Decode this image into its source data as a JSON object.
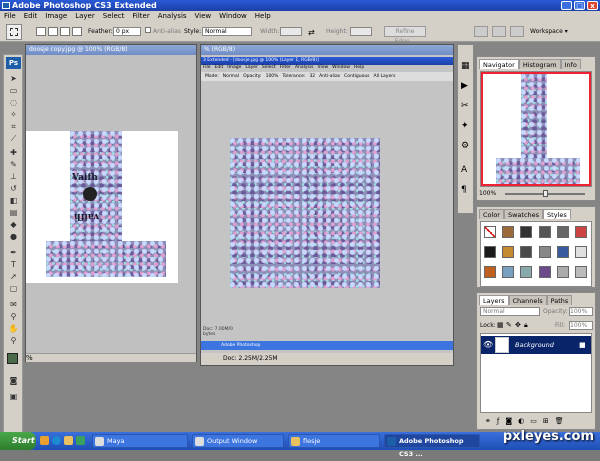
{
  "window": {
    "title": "Adobe Photoshop CS3 Extended",
    "controls": [
      "_",
      "□",
      "x"
    ]
  },
  "menu": [
    "File",
    "Edit",
    "Image",
    "Layer",
    "Select",
    "Filter",
    "Analysis",
    "View",
    "Window",
    "Help"
  ],
  "options": {
    "feather_label": "Feather:",
    "feather_value": "0 px",
    "antialias_label": "Anti-alias",
    "style_label": "Style:",
    "style_value": "Normal",
    "width_label": "Width:",
    "height_label": "Height:",
    "refine_edge": "Refine Edge...",
    "workspace": "Workspace"
  },
  "toolbox": {
    "logo": "Ps"
  },
  "doc1": {
    "title": "doosje copy.jpg @ 100% (RGB/8)",
    "zoom": "%",
    "text1": "Vaifh",
    "text2": "vaifh"
  },
  "doc2": {
    "title": "% (RGB/8)",
    "inner_title": "3 Extended - [doosje.jpg @ 100% (Layer 1, RGB/8)]",
    "inner_menu": [
      "File",
      "Edit",
      "Image",
      "Layer",
      "Select",
      "Filter",
      "Analysis",
      "View",
      "Window",
      "Help"
    ],
    "inner_options": [
      "Mode:",
      "Normal",
      "Opacity:",
      "100%",
      "Tolerance:",
      "32",
      "Anti-alias",
      "Contiguous",
      "All Layers"
    ],
    "doc_size": "Doc: 2.25M/2.25M",
    "inner_status": "Doc: 7.00M/0 bytes",
    "inner_task": "Adobe Photoshop"
  },
  "navigator": {
    "tabs": [
      "Navigator",
      "Histogram",
      "Info"
    ],
    "zoom": "100%"
  },
  "swatches": {
    "tabs": [
      "Color",
      "Swatches",
      "Styles"
    ]
  },
  "layers": {
    "tabs": [
      "Layers",
      "Channels",
      "Paths"
    ],
    "blend_mode": "Normal",
    "opacity_label": "Opacity:",
    "opacity_value": "100%",
    "lock_label": "Lock:",
    "fill_label": "Fill:",
    "fill_value": "100%",
    "layer_name": "Background"
  },
  "taskbar": {
    "start": "Start",
    "items": [
      "Maya",
      "Output Window",
      "flesje",
      "Adobe Photoshop CS3 ..."
    ]
  },
  "watermark": "pxleyes.com"
}
